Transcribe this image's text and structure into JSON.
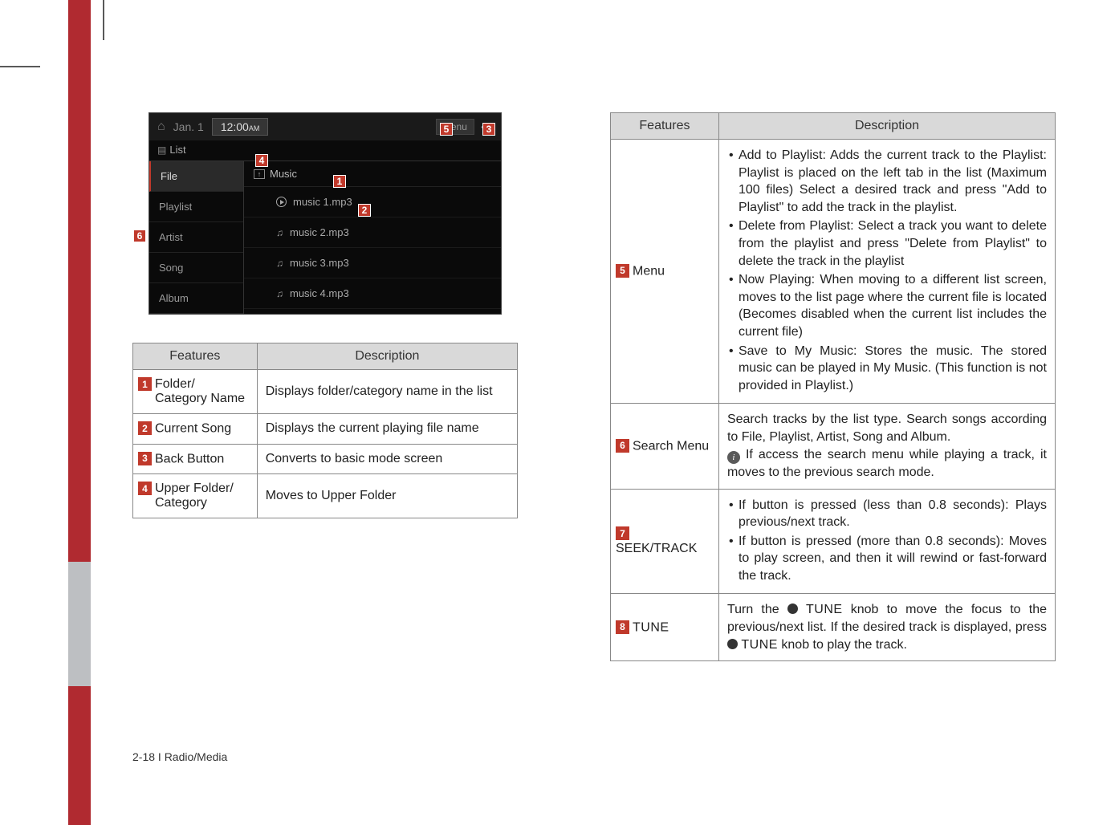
{
  "device": {
    "date": "Jan. 1",
    "time": "12:00",
    "time_suffix": "AM",
    "menu_label": "Menu",
    "list_label": "List",
    "side_items": [
      "File",
      "Playlist",
      "Artist",
      "Song",
      "Album"
    ],
    "folder_name": "Music",
    "tracks": [
      "music 1.mp3",
      "music 2.mp3",
      "music 3.mp3",
      "music 4.mp3"
    ]
  },
  "callouts": {
    "c1": "1",
    "c2": "2",
    "c3": "3",
    "c4": "4",
    "c5": "5",
    "c6": "6"
  },
  "left_table": {
    "headers": [
      "Features",
      "Description"
    ],
    "rows": [
      {
        "num": "1",
        "feature": "Folder/\nCategory Name",
        "desc": "Displays folder/category name in the list"
      },
      {
        "num": "2",
        "feature": "Current Song",
        "desc": "Displays the current playing file name"
      },
      {
        "num": "3",
        "feature": "Back Button",
        "desc": "Converts to basic mode screen"
      },
      {
        "num": "4",
        "feature": "Upper Folder/\nCategory",
        "desc": "Moves to Upper Folder"
      }
    ]
  },
  "right_table": {
    "headers": [
      "Features",
      "Description"
    ],
    "rows": [
      {
        "num": "5",
        "feature": "Menu",
        "desc_items": [
          "Add to Playlist: Adds the current track to the Playlist: Playlist is placed on the left tab in the list (Maximum 100 files) Select a desired track and press \"Add to Playlist\" to add the track in the playlist.",
          "Delete from Playlist: Select a track you want to delete from the playlist and press \"Delete from Playlist\" to delete the track in the playlist",
          "Now Playing: When moving to a different list screen, moves to the list page where the current file is located (Becomes disabled when the current list includes the current file)",
          "Save to My Music: Stores the music. The stored music can be played in My Music. (This function is not provided in Playlist.)"
        ]
      },
      {
        "num": "6",
        "feature": "Search Menu",
        "desc_plain_pre": "Search tracks by the list type. Search songs according to File, Playlist, Artist, Song and Album.",
        "desc_plain_post": "If access the search menu while playing a track, it moves to the previous search mode."
      },
      {
        "num": "7",
        "feature": "SEEK/TRACK",
        "desc_items": [
          "If button is pressed (less than 0.8 seconds): Plays previous/next track.",
          "If button is pressed (more than 0.8 seconds): Moves to play screen, and then it will rewind or fast-forward the track."
        ]
      },
      {
        "num": "8",
        "feature": "TUNE",
        "tune_pre": "Turn the ",
        "tune_mid1": " knob to move the focus to the previous/next list. If the desired track is displayed, press ",
        "tune_knob": "TUNE",
        "tune_post": " knob to play the track."
      }
    ]
  },
  "footer": "2-18 I Radio/Media"
}
